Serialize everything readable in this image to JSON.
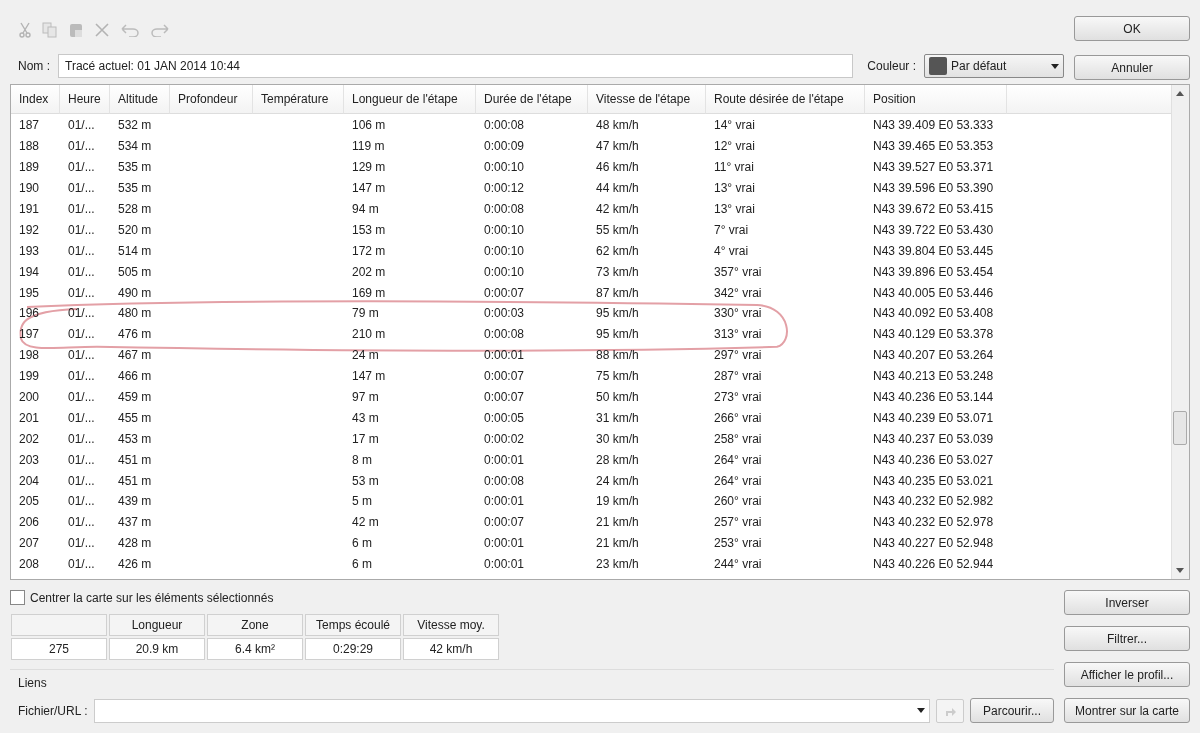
{
  "toolbar": [
    {
      "disabled": true
    },
    {
      "disabled": true
    },
    {
      "disabled": true
    },
    {
      "disabled": true
    },
    {
      "disabled": true
    },
    {
      "disabled": true
    }
  ],
  "name_field": {
    "label": "Nom :",
    "value": "Tracé actuel: 01 JAN 2014 10:44"
  },
  "color_field": {
    "label": "Couleur :",
    "value": "Par défaut",
    "color": "#555555"
  },
  "dialog_buttons": [
    "OK",
    "Annuler"
  ],
  "table": {
    "columns": [
      "Index",
      "Heure",
      "Altitude",
      "Profondeur",
      "Température",
      "Longueur de l'étape",
      "Durée de l'étape",
      "Vitesse de l'étape",
      "Route désirée de l'étape",
      "Position"
    ],
    "rows": [
      {
        "cells": [
          "187",
          "01/...",
          "532 m",
          "",
          "",
          "106 m",
          "0:00:08",
          "48 km/h",
          "14° vrai",
          "N43 39.409 E0 53.333"
        ],
        "circled": false
      },
      {
        "cells": [
          "188",
          "01/...",
          "534 m",
          "",
          "",
          "119 m",
          "0:00:09",
          "47 km/h",
          "12° vrai",
          "N43 39.465 E0 53.353"
        ],
        "circled": false
      },
      {
        "cells": [
          "189",
          "01/...",
          "535 m",
          "",
          "",
          "129 m",
          "0:00:10",
          "46 km/h",
          "11° vrai",
          "N43 39.527 E0 53.371"
        ],
        "circled": false
      },
      {
        "cells": [
          "190",
          "01/...",
          "535 m",
          "",
          "",
          "147 m",
          "0:00:12",
          "44 km/h",
          "13° vrai",
          "N43 39.596 E0 53.390"
        ],
        "circled": false
      },
      {
        "cells": [
          "191",
          "01/...",
          "528 m",
          "",
          "",
          "94 m",
          "0:00:08",
          "42 km/h",
          "13° vrai",
          "N43 39.672 E0 53.415"
        ],
        "circled": false
      },
      {
        "cells": [
          "192",
          "01/...",
          "520 m",
          "",
          "",
          "153 m",
          "0:00:10",
          "55 km/h",
          "7° vrai",
          "N43 39.722 E0 53.430"
        ],
        "circled": false
      },
      {
        "cells": [
          "193",
          "01/...",
          "514 m",
          "",
          "",
          "172 m",
          "0:00:10",
          "62 km/h",
          "4° vrai",
          "N43 39.804 E0 53.445"
        ],
        "circled": false
      },
      {
        "cells": [
          "194",
          "01/...",
          "505 m",
          "",
          "",
          "202 m",
          "0:00:10",
          "73 km/h",
          "357° vrai",
          "N43 39.896 E0 53.454"
        ],
        "circled": false
      },
      {
        "cells": [
          "195",
          "01/...",
          "490 m",
          "",
          "",
          "169 m",
          "0:00:07",
          "87 km/h",
          "342° vrai",
          "N43 40.005 E0 53.446"
        ],
        "circled": false
      },
      {
        "cells": [
          "196",
          "01/...",
          "480 m",
          "",
          "",
          "79 m",
          "0:00:03",
          "95 km/h",
          "330° vrai",
          "N43 40.092 E0 53.408"
        ],
        "circled": true
      },
      {
        "cells": [
          "197",
          "01/...",
          "476 m",
          "",
          "",
          "210 m",
          "0:00:08",
          "95 km/h",
          "313° vrai",
          "N43 40.129 E0 53.378"
        ],
        "circled": true
      },
      {
        "cells": [
          "198",
          "01/...",
          "467 m",
          "",
          "",
          "24 m",
          "0:00:01",
          "88 km/h",
          "297° vrai",
          "N43 40.207 E0 53.264"
        ],
        "circled": false
      },
      {
        "cells": [
          "199",
          "01/...",
          "466 m",
          "",
          "",
          "147 m",
          "0:00:07",
          "75 km/h",
          "287° vrai",
          "N43 40.213 E0 53.248"
        ],
        "circled": false
      },
      {
        "cells": [
          "200",
          "01/...",
          "459 m",
          "",
          "",
          "97 m",
          "0:00:07",
          "50 km/h",
          "273° vrai",
          "N43 40.236 E0 53.144"
        ],
        "circled": false
      },
      {
        "cells": [
          "201",
          "01/...",
          "455 m",
          "",
          "",
          "43 m",
          "0:00:05",
          "31 km/h",
          "266° vrai",
          "N43 40.239 E0 53.071"
        ],
        "circled": false
      },
      {
        "cells": [
          "202",
          "01/...",
          "453 m",
          "",
          "",
          "17 m",
          "0:00:02",
          "30 km/h",
          "258° vrai",
          "N43 40.237 E0 53.039"
        ],
        "circled": false
      },
      {
        "cells": [
          "203",
          "01/...",
          "451 m",
          "",
          "",
          "8 m",
          "0:00:01",
          "28 km/h",
          "264° vrai",
          "N43 40.236 E0 53.027"
        ],
        "circled": false
      },
      {
        "cells": [
          "204",
          "01/...",
          "451 m",
          "",
          "",
          "53 m",
          "0:00:08",
          "24 km/h",
          "264° vrai",
          "N43 40.235 E0 53.021"
        ],
        "circled": false
      },
      {
        "cells": [
          "205",
          "01/...",
          "439 m",
          "",
          "",
          "5 m",
          "0:00:01",
          "19 km/h",
          "260° vrai",
          "N43 40.232 E0 52.982"
        ],
        "circled": false
      },
      {
        "cells": [
          "206",
          "01/...",
          "437 m",
          "",
          "",
          "42 m",
          "0:00:07",
          "21 km/h",
          "257° vrai",
          "N43 40.232 E0 52.978"
        ],
        "circled": false
      },
      {
        "cells": [
          "207",
          "01/...",
          "428 m",
          "",
          "",
          "6 m",
          "0:00:01",
          "21 km/h",
          "253° vrai",
          "N43 40.227 E0 52.948"
        ],
        "circled": false
      },
      {
        "cells": [
          "208",
          "01/...",
          "426 m",
          "",
          "",
          "6 m",
          "0:00:01",
          "23 km/h",
          "244° vrai",
          "N43 40.226 E0 52.944"
        ],
        "circled": false
      }
    ]
  },
  "center_checkbox": {
    "label": "Centrer la carte sur les éléments sélectionnés",
    "checked": false
  },
  "stats": {
    "columns": [
      "",
      "Longueur",
      "Zone",
      "Temps écoulé",
      "Vitesse moy."
    ],
    "values": [
      "275",
      "20.9 km",
      "6.4 km²",
      "0:29:29",
      "42 km/h"
    ]
  },
  "side_buttons": [
    "Inverser",
    "Filtrer...",
    "Afficher le profil...",
    "Montrer sur la carte"
  ],
  "links": {
    "title": "Liens",
    "label": "Fichier/URL :",
    "browse": "Parcourir..."
  }
}
